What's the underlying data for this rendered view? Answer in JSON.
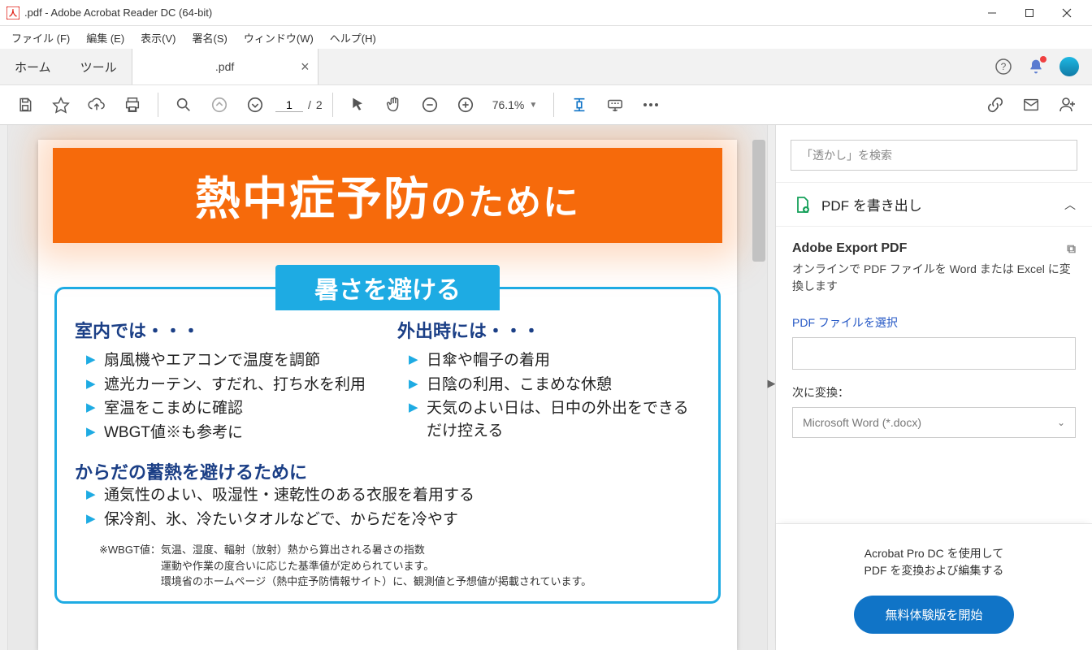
{
  "window": {
    "title": ".pdf - Adobe Acrobat Reader DC (64-bit)"
  },
  "menu": {
    "file": "ファイル (F)",
    "edit": "編集 (E)",
    "view": "表示(V)",
    "sign": "署名(S)",
    "window": "ウィンドウ(W)",
    "help": "ヘルプ(H)"
  },
  "tabs": {
    "home": "ホーム",
    "tools": "ツール",
    "doc_name": ".pdf"
  },
  "toolbar": {
    "page_current": "1",
    "page_sep": "/",
    "page_total": "2",
    "zoom": "76.1%"
  },
  "doc": {
    "banner_main": "熱中症予防",
    "banner_sub": "のために",
    "section_title": "暑さを避ける",
    "indoor_title": "室内では・・・",
    "indoor_items": [
      "扇風機やエアコンで温度を調節",
      "遮光カーテン、すだれ、打ち水を利用",
      "室温をこまめに確認",
      "WBGT値※も参考に"
    ],
    "outdoor_title": "外出時には・・・",
    "outdoor_items": [
      "日傘や帽子の着用",
      "日陰の利用、こまめな休憩",
      "天気のよい日は、日中の外出をできるだけ控える"
    ],
    "sub_title": "からだの蓄熱を避けるために",
    "sub_items": [
      "通気性のよい、吸湿性・速乾性のある衣服を着用する",
      "保冷剤、氷、冷たいタオルなどで、からだを冷やす"
    ],
    "footnote_label": "※WBGT値：",
    "footnote_l1": "気温、湿度、輻射（放射）熱から算出される暑さの指数",
    "footnote_l2": "運動や作業の度合いに応じた基準値が定められています。",
    "footnote_l3": "環境省のホームページ（熱中症予防情報サイト）に、観測値と予想値が掲載されています。"
  },
  "side": {
    "search_placeholder": "「透かし」を検索",
    "export_head": "PDF を書き出し",
    "export_title": "Adobe Export PDF",
    "export_desc": "オンラインで PDF ファイルを Word または Excel に変換します",
    "select_file": "PDF ファイルを選択",
    "convert_label": "次に変換：",
    "format_selected": "Microsoft Word (*.docx)",
    "promo_l1": "Acrobat Pro DC を使用して",
    "promo_l2": "PDF を変換および編集する",
    "cta": "無料体験版を開始"
  }
}
